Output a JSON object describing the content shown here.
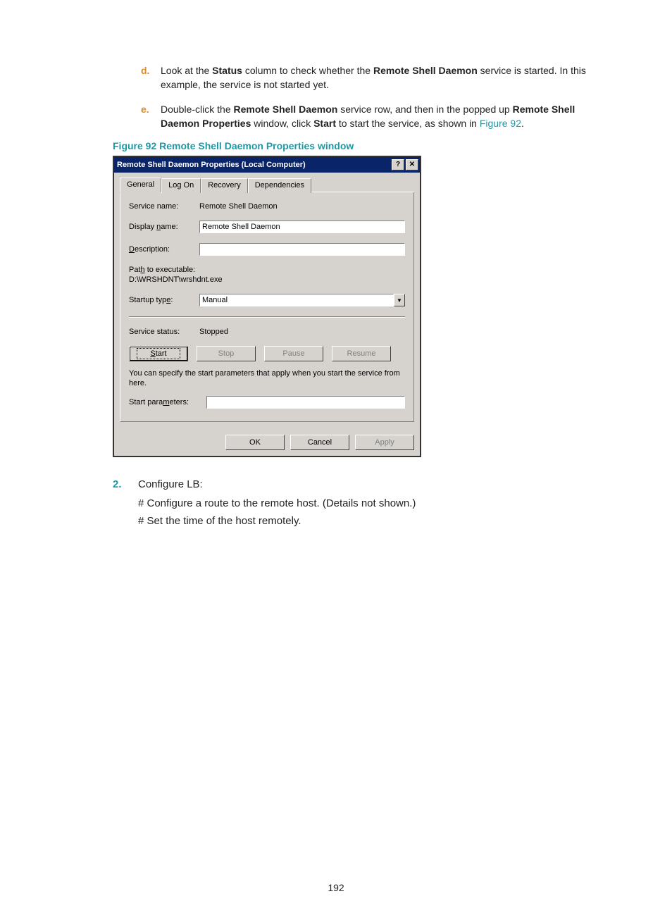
{
  "steps": {
    "d": {
      "letter": "d.",
      "pre1": "Look at the ",
      "b1": "Status",
      "mid1": " column to check whether the ",
      "b2": "Remote Shell Daemon",
      "post1": " service is started. In this example, the service is not started yet."
    },
    "e": {
      "letter": "e.",
      "pre1": "Double-click the ",
      "b1": "Remote Shell Daemon",
      "mid1": " service row, and then in the popped up ",
      "b2": "Remote Shell Daemon Properties",
      "mid2": " window, click ",
      "b3": "Start",
      "mid3": " to start the service, as shown in ",
      "link": "Figure 92",
      "post": "."
    }
  },
  "caption": "Figure 92 Remote Shell Daemon Properties window",
  "dialog": {
    "title": "Remote Shell Daemon Properties (Local Computer)",
    "help_glyph": "?",
    "close_glyph": "✕",
    "tabs": {
      "general": "General",
      "logon": "Log On",
      "recovery": "Recovery",
      "dependencies": "Dependencies"
    },
    "labels": {
      "service_name": "Service name:",
      "display_name_pre": "Display ",
      "display_name_ul": "n",
      "display_name_post": "ame:",
      "description_ul": "D",
      "description_post": "escription:",
      "path_pre": "Pat",
      "path_ul": "h",
      "path_post": " to executable:",
      "startup_pre": "Startup typ",
      "startup_ul": "e",
      "startup_post": ":",
      "status": "Service status:",
      "note": "You can specify the start parameters that apply when you start the service from here.",
      "params_pre": "Start para",
      "params_ul": "m",
      "params_post": "eters:"
    },
    "values": {
      "service_name": "Remote Shell Daemon",
      "display_name": "Remote Shell Daemon",
      "description": "",
      "path": "D:\\WRSHDNT\\wrshdnt.exe",
      "startup_type": "Manual",
      "status": "Stopped",
      "start_params": ""
    },
    "buttons": {
      "start_ul": "S",
      "start_post": "tart",
      "stop": "Stop",
      "pause": "Pause",
      "resume": "Resume",
      "ok": "OK",
      "cancel": "Cancel",
      "apply": "Apply"
    },
    "dropdown_glyph": "▼"
  },
  "after": {
    "num": "2.",
    "text": "Configure LB:",
    "hash1": "# Configure a route to the remote host. (Details not shown.)",
    "hash2": "# Set the time of the host remotely."
  },
  "page_number": "192"
}
